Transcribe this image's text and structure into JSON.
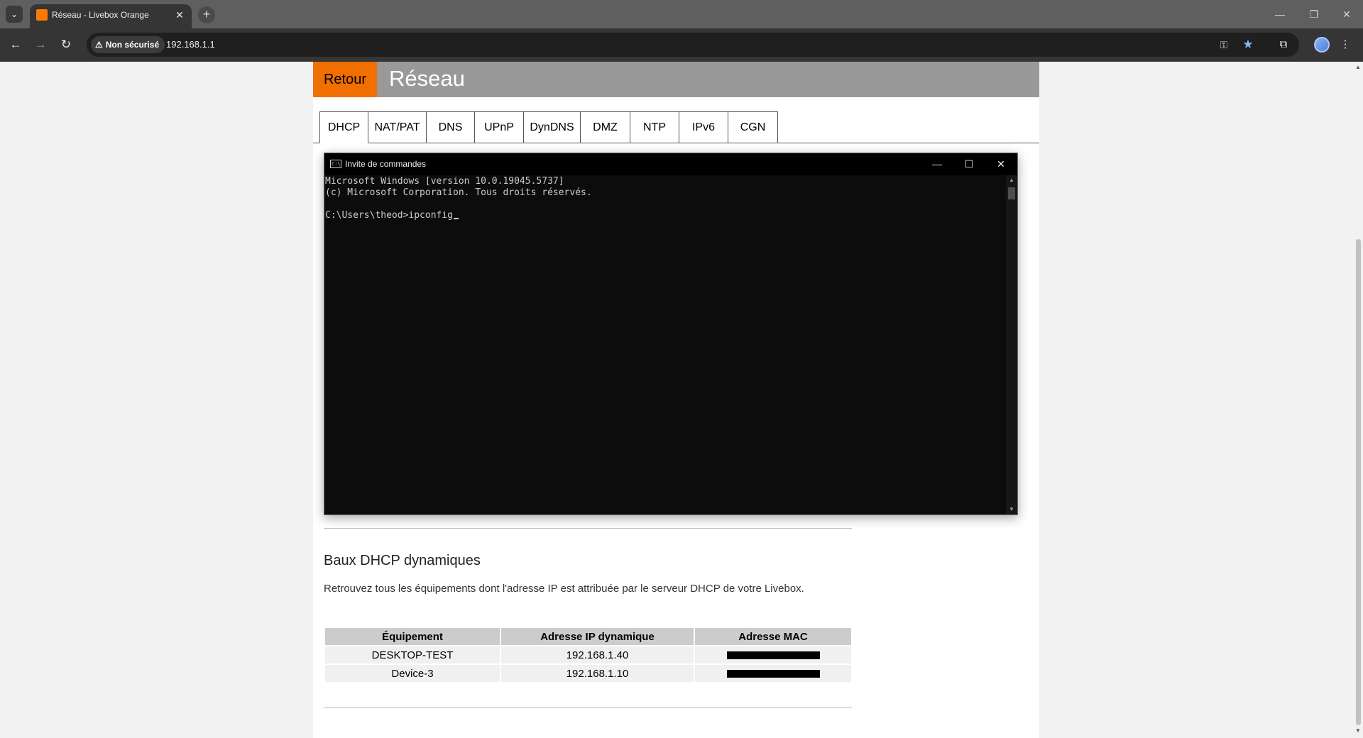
{
  "browser": {
    "tab_title": "Réseau - Livebox Orange",
    "tab_close": "✕",
    "new_tab": "+",
    "security_label": "Non sécurisé",
    "url": "192.168.1.1"
  },
  "page": {
    "back_label": "Retour",
    "title": "Réseau",
    "tabs": [
      "DHCP",
      "NAT/PAT",
      "DNS",
      "UPnP",
      "DynDNS",
      "DMZ",
      "NTP",
      "IPv6",
      "CGN"
    ],
    "active_tab": "DHCP"
  },
  "cmd": {
    "title": "Invite de commandes",
    "line1": "Microsoft Windows [version 10.0.19045.5737]",
    "line2": "(c) Microsoft Corporation. Tous droits réservés.",
    "prompt": "C:\\Users\\theod>ipconfig"
  },
  "dhcp": {
    "section_title": "Baux DHCP dynamiques",
    "description": "Retrouvez tous les équipements dont l'adresse IP est attribuée par le serveur DHCP de votre Livebox.",
    "headers": [
      "Équipement",
      "Adresse IP dynamique",
      "Adresse MAC"
    ],
    "rows": [
      {
        "device": "DESKTOP-TEST",
        "ip": "192.168.1.40"
      },
      {
        "device": "Device-3",
        "ip": "192.168.1.10"
      }
    ]
  },
  "colors": {
    "orange": "#f16e00",
    "header_grey": "#999999",
    "cmd_background": "#0c0c0c"
  }
}
